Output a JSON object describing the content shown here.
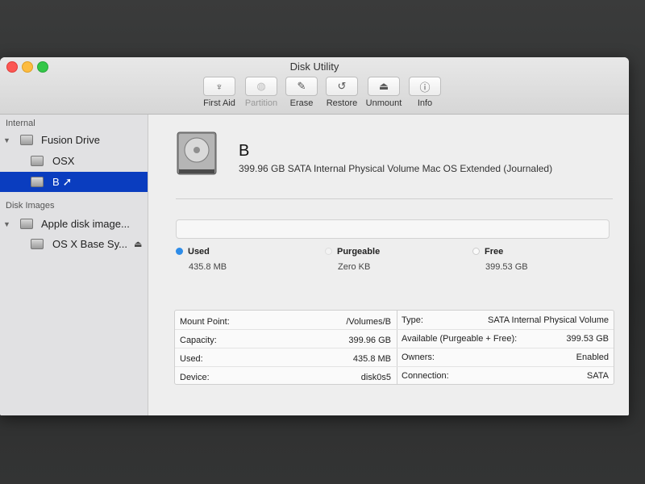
{
  "window": {
    "title": "Disk Utility"
  },
  "toolbar": [
    {
      "label": "First Aid",
      "icon": "stethoscope-icon",
      "glyph": "♆",
      "enabled": true
    },
    {
      "label": "Partition",
      "icon": "partition-icon",
      "glyph": "◍",
      "enabled": false
    },
    {
      "label": "Erase",
      "icon": "erase-icon",
      "glyph": "✎",
      "enabled": true
    },
    {
      "label": "Restore",
      "icon": "restore-icon",
      "glyph": "↺",
      "enabled": true
    },
    {
      "label": "Unmount",
      "icon": "unmount-icon",
      "glyph": "⏏",
      "enabled": true
    },
    {
      "label": "Info",
      "icon": "info-icon",
      "glyph": "ⓘ",
      "enabled": true
    }
  ],
  "sidebar": {
    "internal_header": "Internal",
    "fusion_drive": "Fusion Drive",
    "osx": "OSX",
    "b": "B",
    "disk_images_header": "Disk Images",
    "apple_disk_image": "Apple disk image...",
    "osx_base": "OS X Base Sy..."
  },
  "volume": {
    "name": "B",
    "description": "399.96 GB SATA Internal Physical Volume Mac OS Extended (Journaled)"
  },
  "usage": {
    "used_label": "Used",
    "used_value": "435.8 MB",
    "used_color": "#2d8ce8",
    "purgeable_label": "Purgeable",
    "purgeable_value": "Zero KB",
    "free_label": "Free",
    "free_value": "399.53 GB"
  },
  "info": {
    "left": [
      {
        "label": "Mount Point:",
        "value": "/Volumes/B"
      },
      {
        "label": "Capacity:",
        "value": "399.96 GB"
      },
      {
        "label": "Used:",
        "value": "435.8 MB"
      },
      {
        "label": "Device:",
        "value": "disk0s5"
      }
    ],
    "right": [
      {
        "label": "Type:",
        "value": "SATA Internal Physical Volume"
      },
      {
        "label": "Available (Purgeable + Free):",
        "value": "399.53 GB"
      },
      {
        "label": "Owners:",
        "value": "Enabled"
      },
      {
        "label": "Connection:",
        "value": "SATA"
      }
    ]
  },
  "colors": {
    "selection": "#0a3dbf",
    "window_bg": "#ebebeb"
  }
}
